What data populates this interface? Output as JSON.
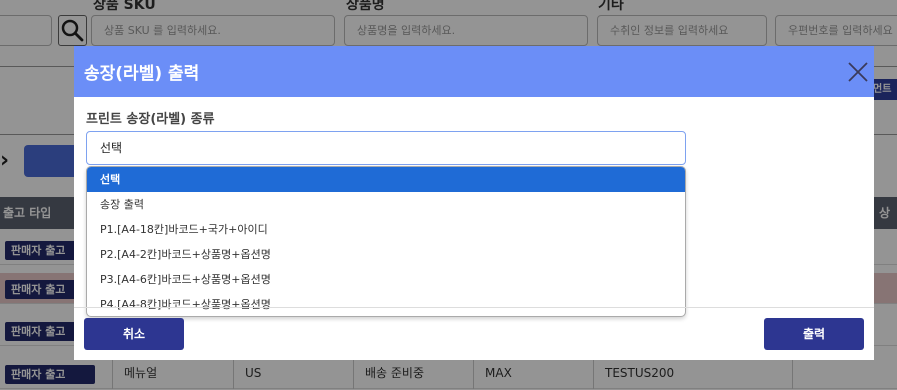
{
  "filters": {
    "sku": {
      "label": "상품 SKU",
      "placeholder": "상품 SKU 를 입력하세요."
    },
    "name": {
      "label": "상품명",
      "placeholder": "상품명을 입력하세요."
    },
    "etc": {
      "label": "기타",
      "placeholder": "수취인 정보를 입력하세요"
    },
    "tracking": {
      "placeholder": "우편번호를 입력하세요"
    }
  },
  "side_tag": "먼트",
  "table": {
    "header_first": "출고 타입",
    "header_last": "상태",
    "rows": [
      {
        "type": "판매자 출고"
      },
      {
        "type": "판매자 출고"
      },
      {
        "type": "판매자 출고"
      },
      {
        "type": "판매자 출고",
        "c2": "메뉴얼",
        "c3": "US",
        "c4": "배송 준비중",
        "c5": "MAX",
        "c6": "TESTUS200"
      }
    ]
  },
  "modal": {
    "title": "송장(라벨) 출력",
    "section_label": "프린트 송장(라벨) 종류",
    "selected_value": "선택",
    "options": [
      "선택",
      "송장 출력",
      "P1.[A4-18칸]바코드+국가+아이디",
      "P2.[A4-2칸]바코드+상품명+옵션명",
      "P3.[A4-6칸]바코드+상품명+옵션명",
      "P4.[A4-8칸]바코드+상품명+옵션명"
    ],
    "cancel_label": "취소",
    "print_label": "출력"
  },
  "colors": {
    "header": "#6b8ef7",
    "button": "#2d3691",
    "selected_option": "#1f6bd6"
  }
}
